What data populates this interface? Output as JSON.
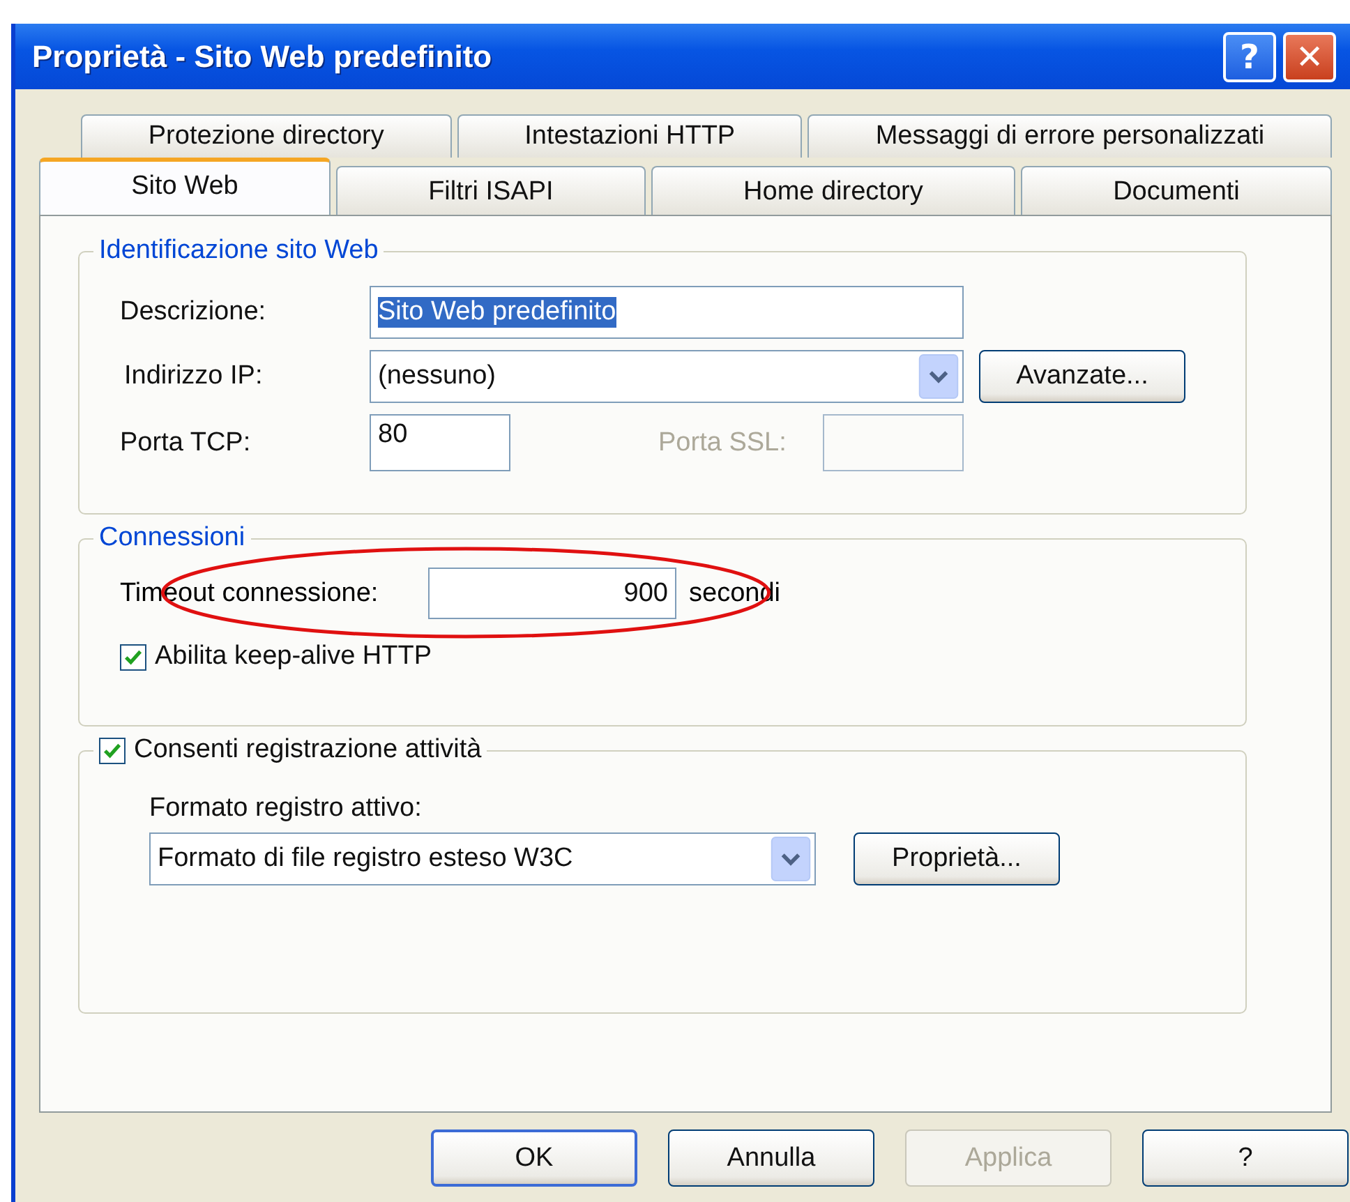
{
  "window": {
    "title": "Proprietà - Sito Web predefinito",
    "title_buttons": [
      {
        "kind": "help",
        "label": "?"
      },
      {
        "kind": "close",
        "label": "✕"
      }
    ]
  },
  "tab_rows": [
    {
      "tabs": [
        {
          "label": "Protezione directory",
          "selected": false
        },
        {
          "label": "Intestazioni HTTP",
          "selected": false
        },
        {
          "label": "Messaggi di errore personalizzati",
          "selected": false
        }
      ]
    },
    {
      "tabs": [
        {
          "label": "Sito Web",
          "selected": true
        },
        {
          "label": "Filtri ISAPI",
          "selected": false
        },
        {
          "label": "Home directory",
          "selected": false
        },
        {
          "label": "Documenti",
          "selected": false
        }
      ]
    }
  ],
  "identification": {
    "legend": "Identificazione sito Web",
    "description": {
      "label": "Descrizione:",
      "value": "Sito Web predefinito",
      "text_selected": true
    },
    "ip": {
      "label": "Indirizzo IP:",
      "value": "(nessuno)",
      "button": "Avanzate..."
    },
    "tcp_port": {
      "label": "Porta TCP:",
      "value": "80"
    },
    "ssl_port": {
      "label": "Porta SSL:",
      "disabled": true
    }
  },
  "connections": {
    "legend": "Connessioni",
    "timeout": {
      "label": "Timeout connessione:",
      "value": "900",
      "unit": "secondi"
    },
    "keep_alive": {
      "label": "Abilita keep-alive HTTP",
      "checked": true
    },
    "annotations": [
      {
        "kind": "ellipse"
      }
    ]
  },
  "logging": {
    "legend": {
      "label": "Consenti registrazione attività",
      "checked": true
    },
    "format_label": "Formato registro attivo:",
    "format": "Formato di file registro esteso W3C",
    "button": "Proprietà..."
  },
  "buttons": [
    {
      "label": "OK",
      "default": true,
      "disabled": false
    },
    {
      "label": "Annulla",
      "default": false,
      "disabled": false
    },
    {
      "label": "Applica",
      "default": false,
      "disabled": true
    },
    {
      "label": "?",
      "default": false,
      "disabled": false
    }
  ]
}
